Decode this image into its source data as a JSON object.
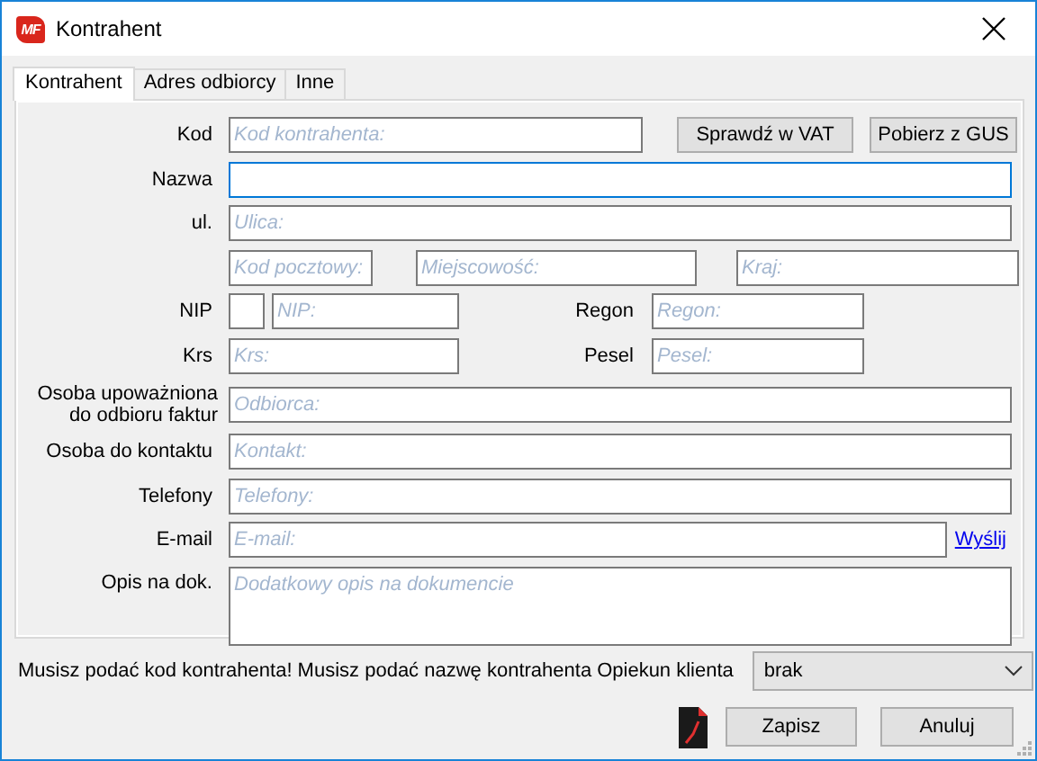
{
  "window": {
    "title": "Kontrahent",
    "logo": "MF"
  },
  "tabs": [
    {
      "label": "Kontrahent",
      "selected": true
    },
    {
      "label": "Adres odbiorcy",
      "selected": false
    },
    {
      "label": "Inne",
      "selected": false
    }
  ],
  "rows": [
    {
      "kind": "code",
      "label": "Kod",
      "placeholder": "Kod kontrahenta:",
      "focused": false,
      "buttons": [
        "Sprawdź w VAT",
        "Pobierz z GUS"
      ]
    },
    {
      "kind": "text",
      "label": "Nazwa",
      "focused": true
    },
    {
      "kind": "text",
      "label": "ul.",
      "placeholder": "Ulica:",
      "focused": false
    },
    {
      "kind": "address",
      "fields": [
        {
          "placeholder": "Kod pocztowy:"
        },
        {
          "placeholder": "Miejscowość:"
        },
        {
          "placeholder": "Kraj:"
        }
      ]
    },
    {
      "kind": "pair",
      "label": "NIP",
      "placeholder": "NIP:",
      "prefix_box": true,
      "right_label": "Regon",
      "right_placeholder": "Regon:"
    },
    {
      "kind": "pair",
      "label": "Krs",
      "placeholder": "Krs:",
      "prefix_box": false,
      "right_label": "Pesel",
      "right_placeholder": "Pesel:"
    },
    {
      "kind": "text",
      "label": "Osoba upoważniona do odbioru faktur",
      "placeholder": "Odbiorca:",
      "focused": false
    },
    {
      "kind": "text",
      "label": "Osoba do kontaktu",
      "placeholder": "Kontakt:",
      "focused": false
    },
    {
      "kind": "text",
      "label": "Telefony",
      "placeholder": "Telefony:",
      "focused": false
    },
    {
      "kind": "email",
      "label": "E-mail",
      "placeholder": "E-mail:",
      "link": "Wyślij"
    },
    {
      "kind": "note",
      "label": "Opis na dok.",
      "placeholder": "Dodatkowy opis na dokumencie"
    }
  ],
  "footer": {
    "message": "Musisz podać kod kontrahenta! Musisz podać nazwę kontrahenta",
    "caretaker_label": "Opiekun klienta",
    "caretaker_value": "brak",
    "buttons": [
      "Zapisz",
      "Anuluj"
    ]
  }
}
